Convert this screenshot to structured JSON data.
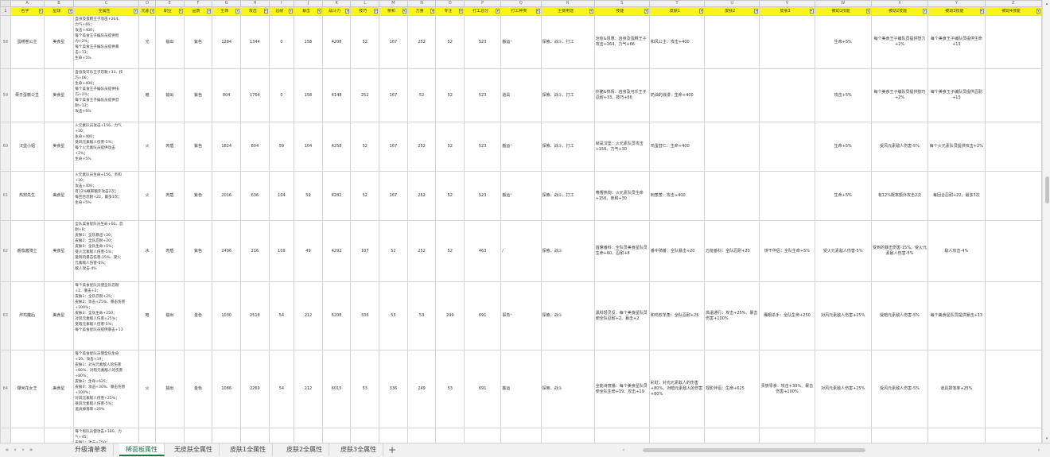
{
  "col_letters": [
    "A",
    "B",
    "C",
    "D",
    "E",
    "F",
    "G",
    "H",
    "I",
    "J",
    "K",
    "L",
    "M",
    "N",
    "O",
    "P",
    "Q",
    "R",
    "S",
    "T",
    "U",
    "V",
    "W",
    "X",
    "Y",
    "Z"
  ],
  "header_row_num": "1",
  "headers": [
    "名字",
    "星球",
    "全属性",
    "元素",
    "职业",
    "品质",
    "生命",
    "攻击",
    "忍耐",
    "暴击",
    "战斗力",
    "技巧",
    "亲和",
    "力量",
    "专注",
    "打工总分",
    "打工种类",
    "主要用途",
    "技能",
    "皮肤1",
    "皮肤2",
    "皮肤3",
    "被动1技能",
    "被动2技能",
    "被动3技能",
    "被动4技能"
  ],
  "rows": [
    {
      "num": "58",
      "cells": [
        "蛋糕卷公主",
        "美食星",
        "",
        "光",
        "输出",
        "紫色",
        "1284",
        "1344",
        "0",
        "158",
        "4208",
        "52",
        "167",
        "252",
        "52",
        "523",
        "搬运⁺",
        "探索、战斗、打工",
        "治愈&恩惠：自身及蛋糕王子攻击+264、力气+66",
        "和风公主：攻击+400",
        "",
        "",
        "生命+5%",
        "每个美食王子编队员提供智力+2%",
        "每个美食王子编队员提供生命+13",
        ""
      ],
      "desc": [
        "自身及蛋糕王子攻击+264、",
        "力气+66；",
        "攻击+400；",
        "每个美食王子编队员提供智",
        "力+2%；",
        "每个美食王子编队员提供暴",
        "击+13；",
        "生命+5%"
      ]
    },
    {
      "num": "59",
      "cells": [
        "栗子蛋糕公主",
        "美食星",
        "",
        "暗",
        "输出",
        "紫色",
        "804",
        "1764",
        "0",
        "158",
        "4148",
        "252",
        "167",
        "52",
        "52",
        "523",
        "道具",
        "探索、战斗、打工",
        "外脆&热情：自身及可乐王子忍耐+33、技巧+66",
        "奶油的浪漫：生命+400",
        "",
        "",
        "攻击+5%",
        "每个美食王子编队员提供技巧+2%",
        "每个美食王子编队员提供忍耐+13",
        ""
      ],
      "desc": [
        "自身及可乐王子忍耐+33、技",
        "巧+66；",
        "生命+400；",
        "每个美食王子编队员提供技",
        "巧+2%；",
        "每个美食王子编队员提供忍",
        "耐+13；",
        "攻击+5%"
      ]
    },
    {
      "num": "60",
      "cells": [
        "汉堡小姐",
        "美食星",
        "",
        "火",
        "肉盾",
        "紫色",
        "1824",
        "804",
        "59",
        "104",
        "4258",
        "52",
        "167",
        "252",
        "52",
        "523",
        "搬运⁺",
        "探索、战斗、打工",
        "就是汉堡：火元素队员攻击+156、力气+30",
        "鸡蛋替仁：生命+400",
        "",
        "",
        "生命+5%",
        "受风元素敌人伤害-5%",
        "每个火元素队员提供攻击+2%",
        ""
      ],
      "desc": [
        "火元素队员攻击+156、力气",
        "+30；",
        "生命+400；",
        "受风元素敌人伤害-5%；",
        "每个火元素队员提供攻击",
        "+2%；",
        "生命+5%"
      ]
    },
    {
      "num": "61",
      "cells": [
        "热狗先生",
        "美食星",
        "",
        "火",
        "肉盾",
        "紫色",
        "2016",
        "636",
        "104",
        "59",
        "4282",
        "52",
        "167",
        "252",
        "52",
        "523",
        "搬运⁺",
        "探索、战斗、打工",
        "嗜香热狗：火元素队员生命+156、亲和+30",
        "刺葱葱：攻击+400",
        "",
        "",
        "生命+5%",
        "有12%概率额外攻击2次",
        "每回合忍耐+22，最多3次",
        ""
      ],
      "desc": [
        "火元素队员生命+156、亲和",
        "+30；",
        "攻击+400；",
        "有12%概率额外攻击2次；",
        "每回合忍耐+22，最多3次；",
        "生命+5%"
      ]
    },
    {
      "num": "62",
      "cells": [
        "番茄酱骑士",
        "美食星",
        "",
        "水",
        "肉盾",
        "紫色",
        "2496",
        "216",
        "109",
        "49",
        "4292",
        "107",
        "52",
        "252",
        "52",
        "463",
        "/",
        "探索、战斗",
        "首席番科：全队员美食星队员生命+60、忍耐+8",
        "番中骑番：全队暴击+20",
        "万能番科：全队忍耐+20",
        "饼干伴侣：全队生命+5%",
        "受火元素敌人伤害-5%",
        "受到的暴击伤害-15%、受火元素敌人伤害-5%",
        "敌人攻击-4%",
        ""
      ],
      "desc": [
        "全队美食星队员生命+60、忍",
        "耐+8；",
        "皮肤1：全队暴击+20；",
        "皮肤2：全队忍耐+20；",
        "皮肤3：全队生命+5%；",
        "受火元素敌人伤害-5%；",
        "受到的暴击伤害-15%、受火",
        "元素敌人伤害-5%；",
        "敌人攻击-4%"
      ]
    },
    {
      "num": "63",
      "cells": [
        "炸鸡魔后",
        "美食星",
        "",
        "暗",
        "输出",
        "金色",
        "1030",
        "2518",
        "54",
        "212",
        "6208",
        "336",
        "53",
        "53",
        "249",
        "691",
        "事务⁺",
        "探索、战斗",
        "黑科轻灵反：每个美食星队员使全队忍耐+2、暴击+2",
        "和鸡软羊角：全队忍耐+25",
        "高温通行：攻击+25%、暴击伤害+100%",
        "鹰眼杀手：全队生命+250",
        "对风元素敌人伤害+25%",
        "受暗元素敌人伤害-5%",
        "每个美食星队员提供暴击+13",
        ""
      ],
      "desc": [
        "每个美食星队员使全队忍耐",
        "+2、暴击+2；",
        "皮肤1：全队忍耐+25；",
        "皮肤2：攻击+25%、暴击伤害",
        "+100%；",
        "皮肤3：全队生命+250；",
        "对风元素敌人伤害+25%；",
        "受暗元素敌人伤害-5%；",
        "每个美食星队员提供暴击+13"
      ]
    },
    {
      "num": "64",
      "cells": [
        "爆米花女王",
        "美食星",
        "",
        "火",
        "输出",
        "金色",
        "1086",
        "2269",
        "54",
        "212",
        "6015",
        "53",
        "336",
        "249",
        "53",
        "691",
        "搬运",
        "探索、战斗",
        "全能诗意播：每个美食星队员使全队生命+19、攻击+19",
        "彩虹：对光元素敌人的伤害+80%、对暗元素敌人的伤害+80%",
        "观影伴侣：生命+625",
        "贵族零食：攻击+30%、暴击伤害+100%",
        "对风元素敌人伤害+25%",
        "受风元素敌人伤害-5%",
        "道具掉落率+25%",
        ""
      ],
      "desc": [
        "每个美食星队员使全队生命",
        "+19、攻击+19；",
        "皮肤1：对光元素敌人的伤害",
        "+80%、对暗元素敌人的伤害",
        "+80%；",
        "皮肤2：生命+625；",
        "皮肤3：攻击+30%、暴击伤害",
        "+100%；",
        "对风元素敌人伤害+25%；",
        "受风元素敌人伤害-5%；",
        "道具掉落率+25%"
      ]
    },
    {
      "num": "",
      "cells": [
        "",
        "",
        "",
        "",
        "",
        "",
        "",
        "",
        "",
        "",
        "",
        "",
        "",
        "",
        "",
        "",
        "",
        "",
        "",
        "",
        "",
        "",
        "",
        "",
        "",
        ""
      ],
      "desc": [
        "每个男队员使攻击+180、力",
        "气+45；",
        "皮肤1：攻击+750；"
      ]
    }
  ],
  "sheet_tabs": [
    "升级清单表",
    "稀面板属性",
    "无皮肤全属性",
    "皮肤1全属性",
    "皮肤2全属性",
    "皮肤3全属性"
  ],
  "active_tab_index": 1,
  "add_sheet_label": "+",
  "icons": {
    "prev": "‹",
    "next": "›",
    "first": "«",
    "last": "»",
    "filter": "▾",
    "up": "▴",
    "down": "▾"
  },
  "colors": {
    "header_fill": "#f9f51b",
    "active_tab": "#217346"
  }
}
